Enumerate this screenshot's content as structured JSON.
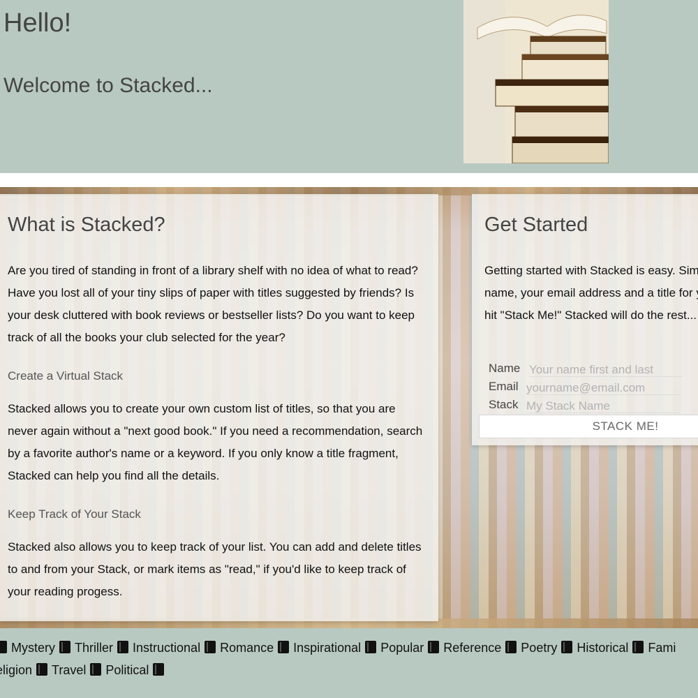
{
  "header": {
    "greeting": "Hello!",
    "welcome": "Welcome to Stacked..."
  },
  "about": {
    "title": "What is Stacked?",
    "intro": "Are you tired of standing in front of a library shelf with no idea of what to read? Have you lost all of your tiny slips of paper with titles suggested by friends? Is your desk cluttered with book reviews or bestseller lists? Do you want to keep track of all the books your club selected for the year?",
    "section1_title": "Create a Virtual Stack",
    "section1_text": "Stacked allows you to create your own custom list of titles, so that you are never again without a \"next good book.\" If you need a recommendation, search by a favorite author's name or a keyword. If you only know a title fragment, Stacked can help you find all the details.",
    "section2_title": "Keep Track of Your Stack",
    "section2_text": "Stacked also allows you to keep track of your list. You can add and delete titles to and from your Stack, or mark items as \"read,\" if you'd like to keep track of your reading progess."
  },
  "get_started": {
    "title": "Get Started",
    "intro": "Getting started with Stacked is easy. Simply enter your name, your email address and a title for your Stack, then hit \"Stack Me!\" Stacked will do the rest...",
    "name_label": "Name",
    "name_placeholder": "Your name first and last",
    "email_label": "Email",
    "email_placeholder": "yourname@email.com",
    "stack_label": "Stack",
    "stack_placeholder": "My Stack Name",
    "submit_label": "STACK ME!"
  },
  "genres": {
    "row1": [
      "Mystery",
      "Thriller",
      "Instructional",
      "Romance",
      "Inspirational",
      "Popular",
      "Reference",
      "Poetry",
      "Historical",
      "Fami"
    ],
    "row2": [
      "eligion",
      "Travel",
      "Political"
    ]
  },
  "icons": {
    "genre_icon": "book-icon"
  }
}
